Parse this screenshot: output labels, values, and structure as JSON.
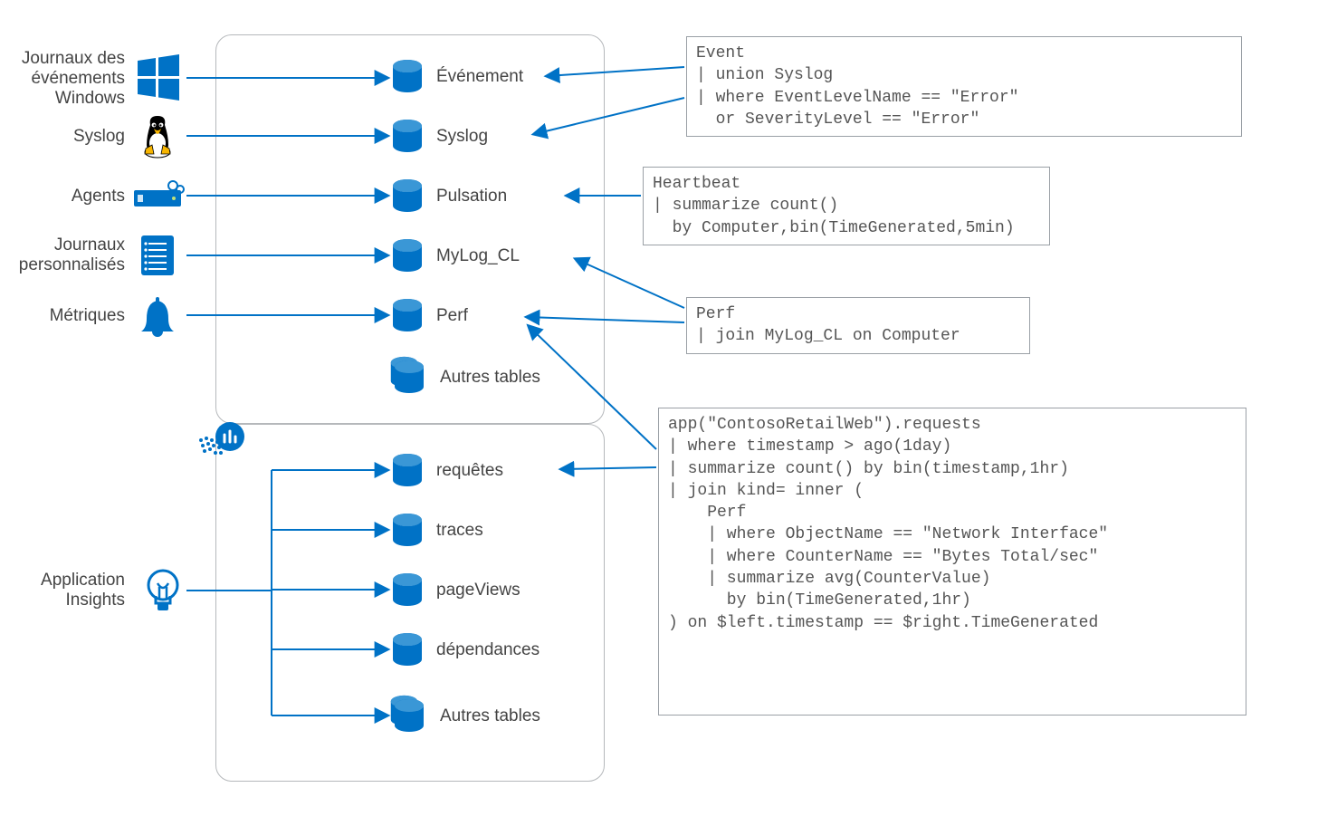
{
  "colors": {
    "azure": "#0072C6",
    "border": "#b5b8bb",
    "qborder": "#9aa0a6",
    "text": "#444"
  },
  "sources": {
    "windows_events": "Journaux des\névénements\nWindows",
    "syslog": "Syslog",
    "agents": "Agents",
    "custom_logs": "Journaux\npersonnalisés",
    "metrics": "Métriques",
    "app_insights": "Application\nInsights"
  },
  "tables_top": {
    "event": "Événement",
    "syslog": "Syslog",
    "heartbeat": "Pulsation",
    "mylog": "MyLog_CL",
    "perf": "Perf",
    "other": "Autres tables"
  },
  "tables_ai": {
    "requests": "requêtes",
    "traces": "traces",
    "pageviews": "pageViews",
    "dependencies": "dépendances",
    "other": "Autres tables"
  },
  "queries": {
    "q1": "Event\n| union Syslog\n| where EventLevelName == \"Error\"\n  or SeverityLevel == \"Error\"",
    "q2": "Heartbeat\n| summarize count()\n  by Computer,bin(TimeGenerated,5min)",
    "q3": "Perf\n| join MyLog_CL on Computer",
    "q4": "app(\"ContosoRetailWeb\").requests\n| where timestamp > ago(1day)\n| summarize count() by bin(timestamp,1hr)\n| join kind= inner (\n    Perf\n    | where ObjectName == \"Network Interface\"\n    | where CounterName == \"Bytes Total/sec\"\n    | summarize avg(CounterValue)\n      by bin(TimeGenerated,1hr)\n) on $left.timestamp == $right.TimeGenerated"
  }
}
